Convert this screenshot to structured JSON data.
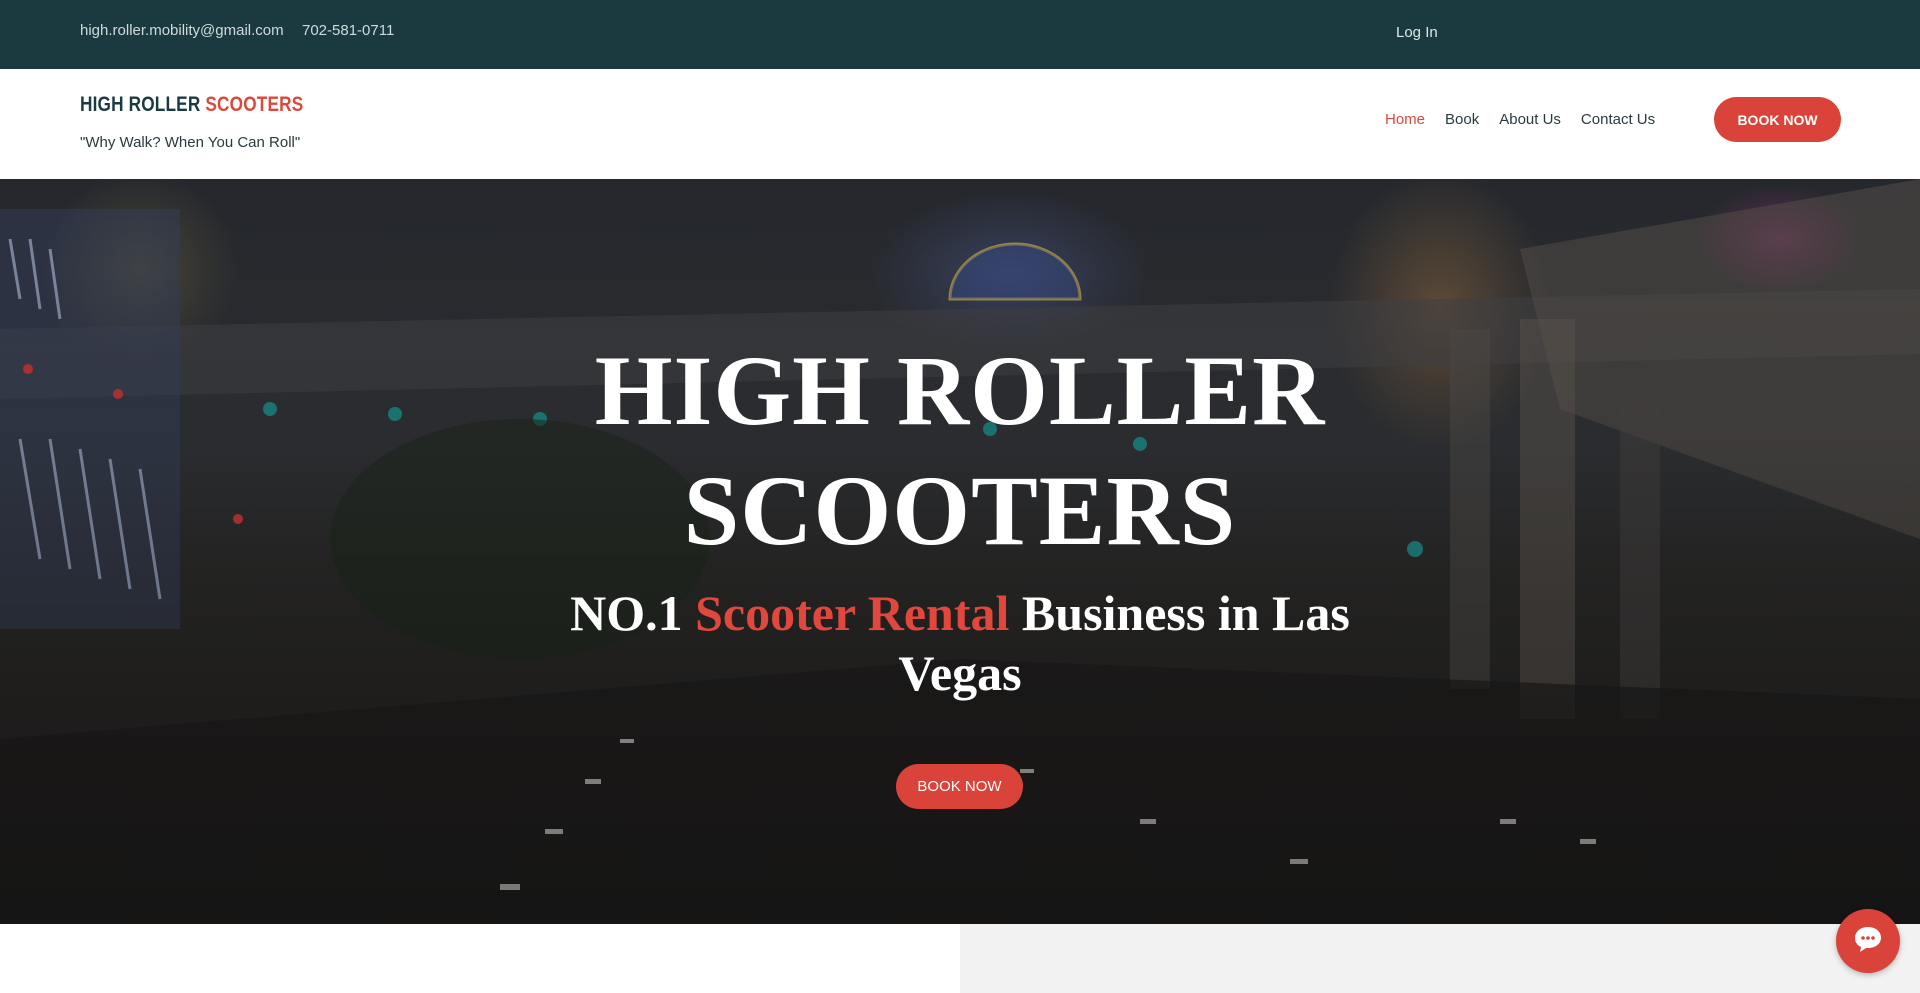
{
  "topbar": {
    "email": "high.roller.mobility@gmail.com",
    "phone": "702-581-0711",
    "login": "Log In"
  },
  "header": {
    "brand_part1": "HIGH ROLLER",
    "brand_part2": "SCOOTERS",
    "tagline": "\"Why Walk? When You Can Roll\"",
    "nav": [
      "Home",
      "Book",
      "About Us",
      "Contact Us"
    ],
    "active_nav": "Home",
    "book_button": "BOOK NOW"
  },
  "hero": {
    "title_line1": "HIGH ROLLER",
    "title_line2": "SCOOTERS",
    "subtitle_pre": "NO.1 ",
    "subtitle_highlight": "Scooter Rental",
    "subtitle_post": " Business in Las Vegas",
    "button": "BOOK NOW"
  },
  "chat": {
    "icon": "chat-icon"
  },
  "colors": {
    "topbar_bg": "#1b3a40",
    "accent": "#d9433a",
    "brand_dark": "#1b3a40"
  }
}
